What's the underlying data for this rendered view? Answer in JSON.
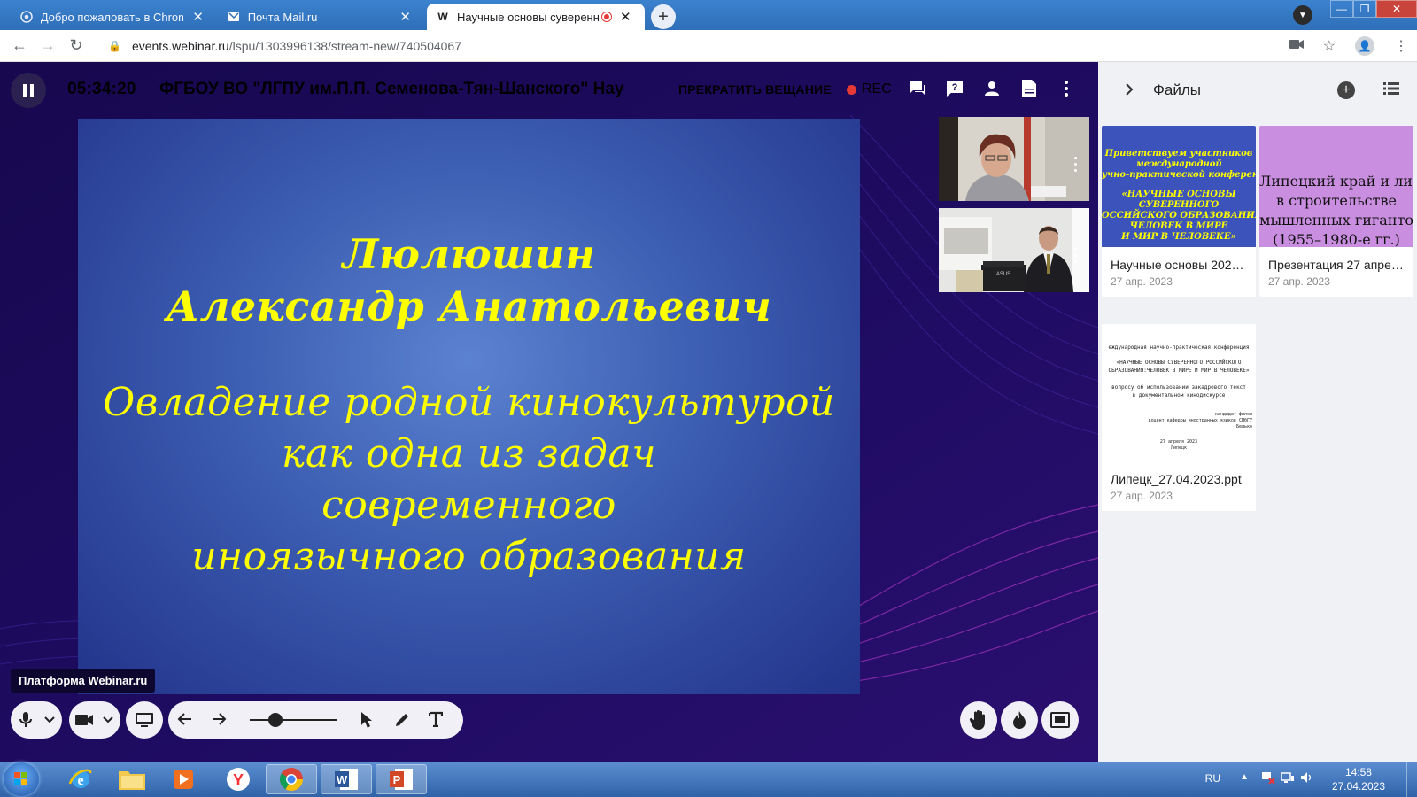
{
  "browser": {
    "tabs": [
      {
        "title": "Добро пожаловать в Chrome!",
        "state": "inactive",
        "icon": "chrome-icon"
      },
      {
        "title": "Почта Mail.ru",
        "state": "inactive",
        "icon": "mail-icon"
      },
      {
        "title": "Научные основы суверенн",
        "state": "active",
        "icon": "webinar-icon",
        "recording": true
      }
    ],
    "new_tab_label": "+",
    "url_host": "events.webinar.ru",
    "url_path": "/lspu/1303996138/stream-new/740504067"
  },
  "stream": {
    "timer": "05:34:20",
    "title": "ФГБОУ ВО \"ЛГПУ им.П.П. Семенова-Тян-Шанского\"   Нау",
    "stop_label": "ПРЕКРАТИТЬ ВЕЩАНИЕ",
    "rec_label": "REC",
    "watermark": "Платформа Webinar.ru"
  },
  "slide": {
    "name_line1": "Люлюшин",
    "name_line2": "Александр Анатольевич",
    "topic_line1": "Овладение родной кинокультурой",
    "topic_line2": "как одна из задач",
    "topic_line3": "современного",
    "topic_line4": "иноязычного образования",
    "text_color": "#ffff00"
  },
  "files_panel": {
    "title": "Файлы",
    "files": [
      {
        "name": "Научные основы 202…",
        "date": "27 апр. 2023",
        "thumb_lines": [
          "Приветствуем участников",
          "международной",
          "учно-практической конференц",
          "«НАУЧНЫЕ ОСНОВЫ",
          "СУВЕРЕННОГО",
          "ОССИЙСКОГО ОБРАЗОВАНИЯ",
          "ЧЕЛОВЕК В МИРЕ",
          "И МИР В ЧЕЛОВЕКЕ»"
        ]
      },
      {
        "name": "Презентация 27 апре…",
        "date": "27 апр. 2023",
        "thumb_lines": [
          "Липецкий край и липча",
          "в строительстве",
          "мышленных гигантов И",
          "(1955–1980-е гг.)"
        ]
      },
      {
        "name": "Липецк_27.04.2023.ppt",
        "date": "27 апр. 2023",
        "thumb_lines": [
          "еждународная научно-практическая конференция",
          "«НАУЧНЫЕ ОСНОВЫ СУВЕРЕННОГО РОССИЙСКОГО",
          "ОБРАЗОВАНИЯ:ЧЕЛОВЕК В МИРЕ И МИР В ЧЕЛОВЕКЕ»",
          "вопросу об использовании закадрового текст",
          "в документальном кинодискурсе",
          "кандидат филол",
          "доцент кафедры иностранных языков СПбГУ",
          "Белько",
          "27 апреля 2023",
          "Липецк"
        ]
      }
    ]
  },
  "taskbar": {
    "lang": "RU",
    "time": "14:58",
    "date": "27.04.2023"
  }
}
